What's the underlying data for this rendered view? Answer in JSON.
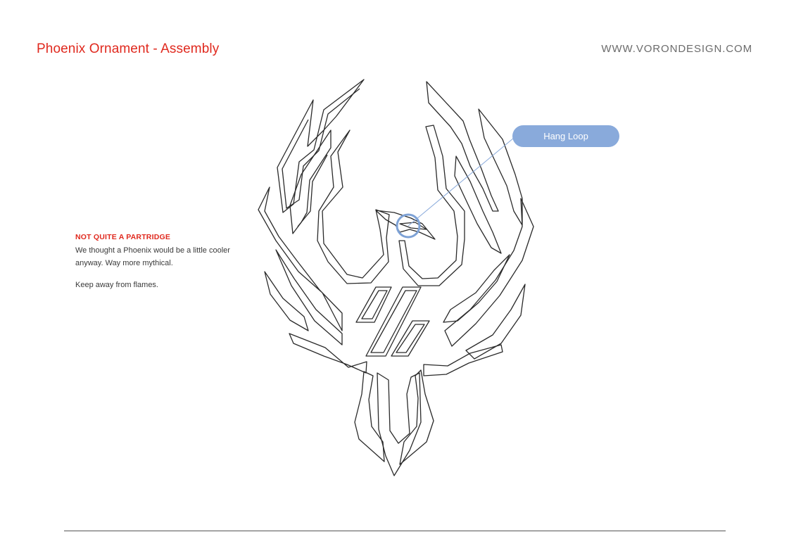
{
  "header": {
    "title": "Phoenix Ornament - Assembly",
    "website": "WWW.VORONDESIGN.COM"
  },
  "note": {
    "heading": "NOT QUITE A PARTRIDGE",
    "body": "We thought a Phoenix would be a little cooler anyway. Way more mythical.",
    "extra": "Keep away from flames."
  },
  "callout": {
    "label": "Hang Loop"
  },
  "colors": {
    "accent_red": "#e0291e",
    "callout_blue": "#89aadb",
    "line_art": "#2a2a2a",
    "text_gray": "#6b6b6b"
  }
}
